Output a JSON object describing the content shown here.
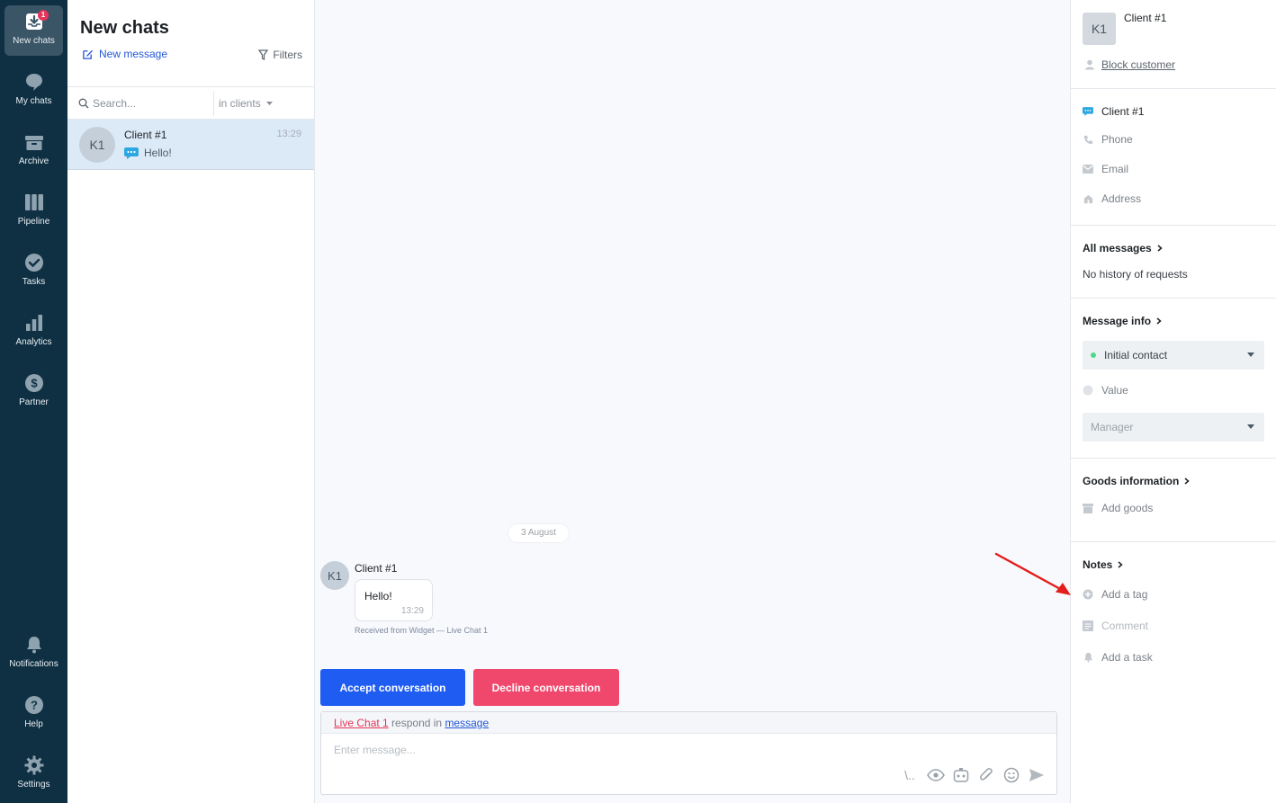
{
  "nav": {
    "items": [
      {
        "label": "New chats",
        "icon": "inbox-icon",
        "badge": "1",
        "active": true
      },
      {
        "label": "My chats",
        "icon": "chat-bubble-icon"
      },
      {
        "label": "Archive",
        "icon": "archive-icon"
      },
      {
        "label": "Pipeline",
        "icon": "pipeline-icon"
      },
      {
        "label": "Tasks",
        "icon": "check-circle-icon"
      },
      {
        "label": "Analytics",
        "icon": "bar-chart-icon"
      },
      {
        "label": "Partner",
        "icon": "dollar-icon"
      }
    ],
    "bottom": [
      {
        "label": "Notifications",
        "icon": "bell-icon"
      },
      {
        "label": "Help",
        "icon": "help-icon"
      },
      {
        "label": "Settings",
        "icon": "gear-icon"
      }
    ]
  },
  "list": {
    "title": "New chats",
    "new_message": "New message",
    "filters": "Filters",
    "search_placeholder": "Search...",
    "search_scope": "in clients",
    "chats": [
      {
        "initials": "K1",
        "name": "Client #1",
        "time": "13:29",
        "preview": "Hello!"
      }
    ]
  },
  "conversation": {
    "date": "3 August",
    "message": {
      "initials": "K1",
      "sender": "Client #1",
      "text": "Hello!",
      "time": "13:29",
      "source": "Received from Widget — Live Chat 1"
    },
    "accept_label": "Accept conversation",
    "decline_label": "Decline conversation",
    "composer": {
      "channel": "Live Chat 1",
      "respond_in": "respond in",
      "mode": "message",
      "placeholder": "Enter message...",
      "slash": "\\.."
    }
  },
  "panel": {
    "initials": "K1",
    "name": "Client #1",
    "block_label": "Block customer",
    "contact": {
      "name": "Client #1",
      "phone": "Phone",
      "email": "Email",
      "address": "Address"
    },
    "all_messages": {
      "title": "All messages",
      "text": "No history of requests"
    },
    "message_info": {
      "title": "Message info",
      "stage": "Initial contact",
      "value": "Value",
      "manager": "Manager"
    },
    "goods": {
      "title": "Goods information",
      "add": "Add goods"
    },
    "notes": {
      "title": "Notes",
      "tag": "Add a tag",
      "comment": "Comment",
      "task": "Add a task"
    }
  },
  "colors": {
    "nav_bg": "#0f3043",
    "accent": "#1f5cf2",
    "decline": "#f0486d",
    "badge": "#e7345a",
    "annotation_arrow": "#e41e1e"
  }
}
